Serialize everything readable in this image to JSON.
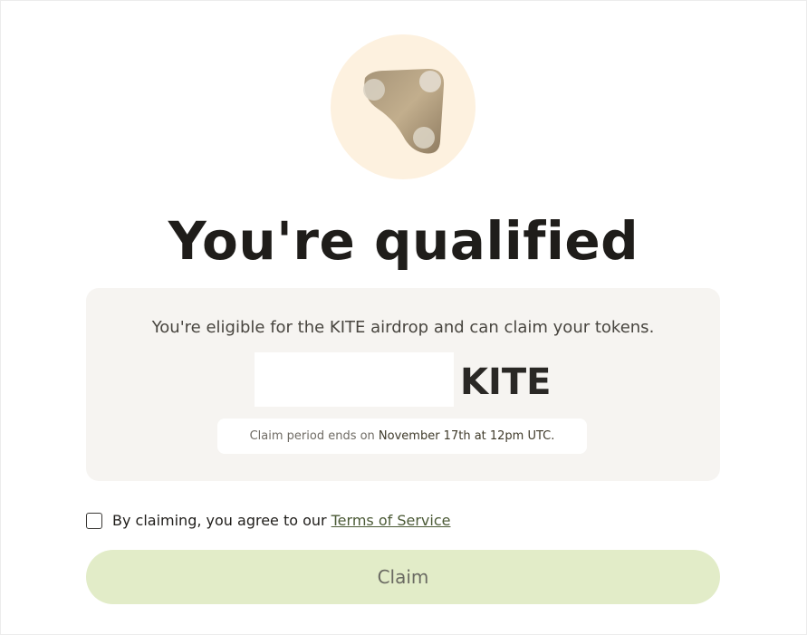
{
  "logo": {
    "icon": "kite-logo-icon"
  },
  "title": "You're qualified",
  "card": {
    "eligible_text": "You're eligible for the KITE airdrop and can claim your tokens.",
    "token_symbol": "KITE",
    "period_prefix": "Claim period ends on ",
    "period_date": "November 17th at 12pm UTC."
  },
  "agreement": {
    "text": "By claiming, you agree to our",
    "link_label": "Terms of Service",
    "checked": false
  },
  "claim_button": {
    "label": "Claim"
  },
  "colors": {
    "logo_bg": "#fdf1df",
    "card_bg": "#f6f4f1",
    "button_bg": "#e2ecc8",
    "link": "#4b5a36"
  }
}
